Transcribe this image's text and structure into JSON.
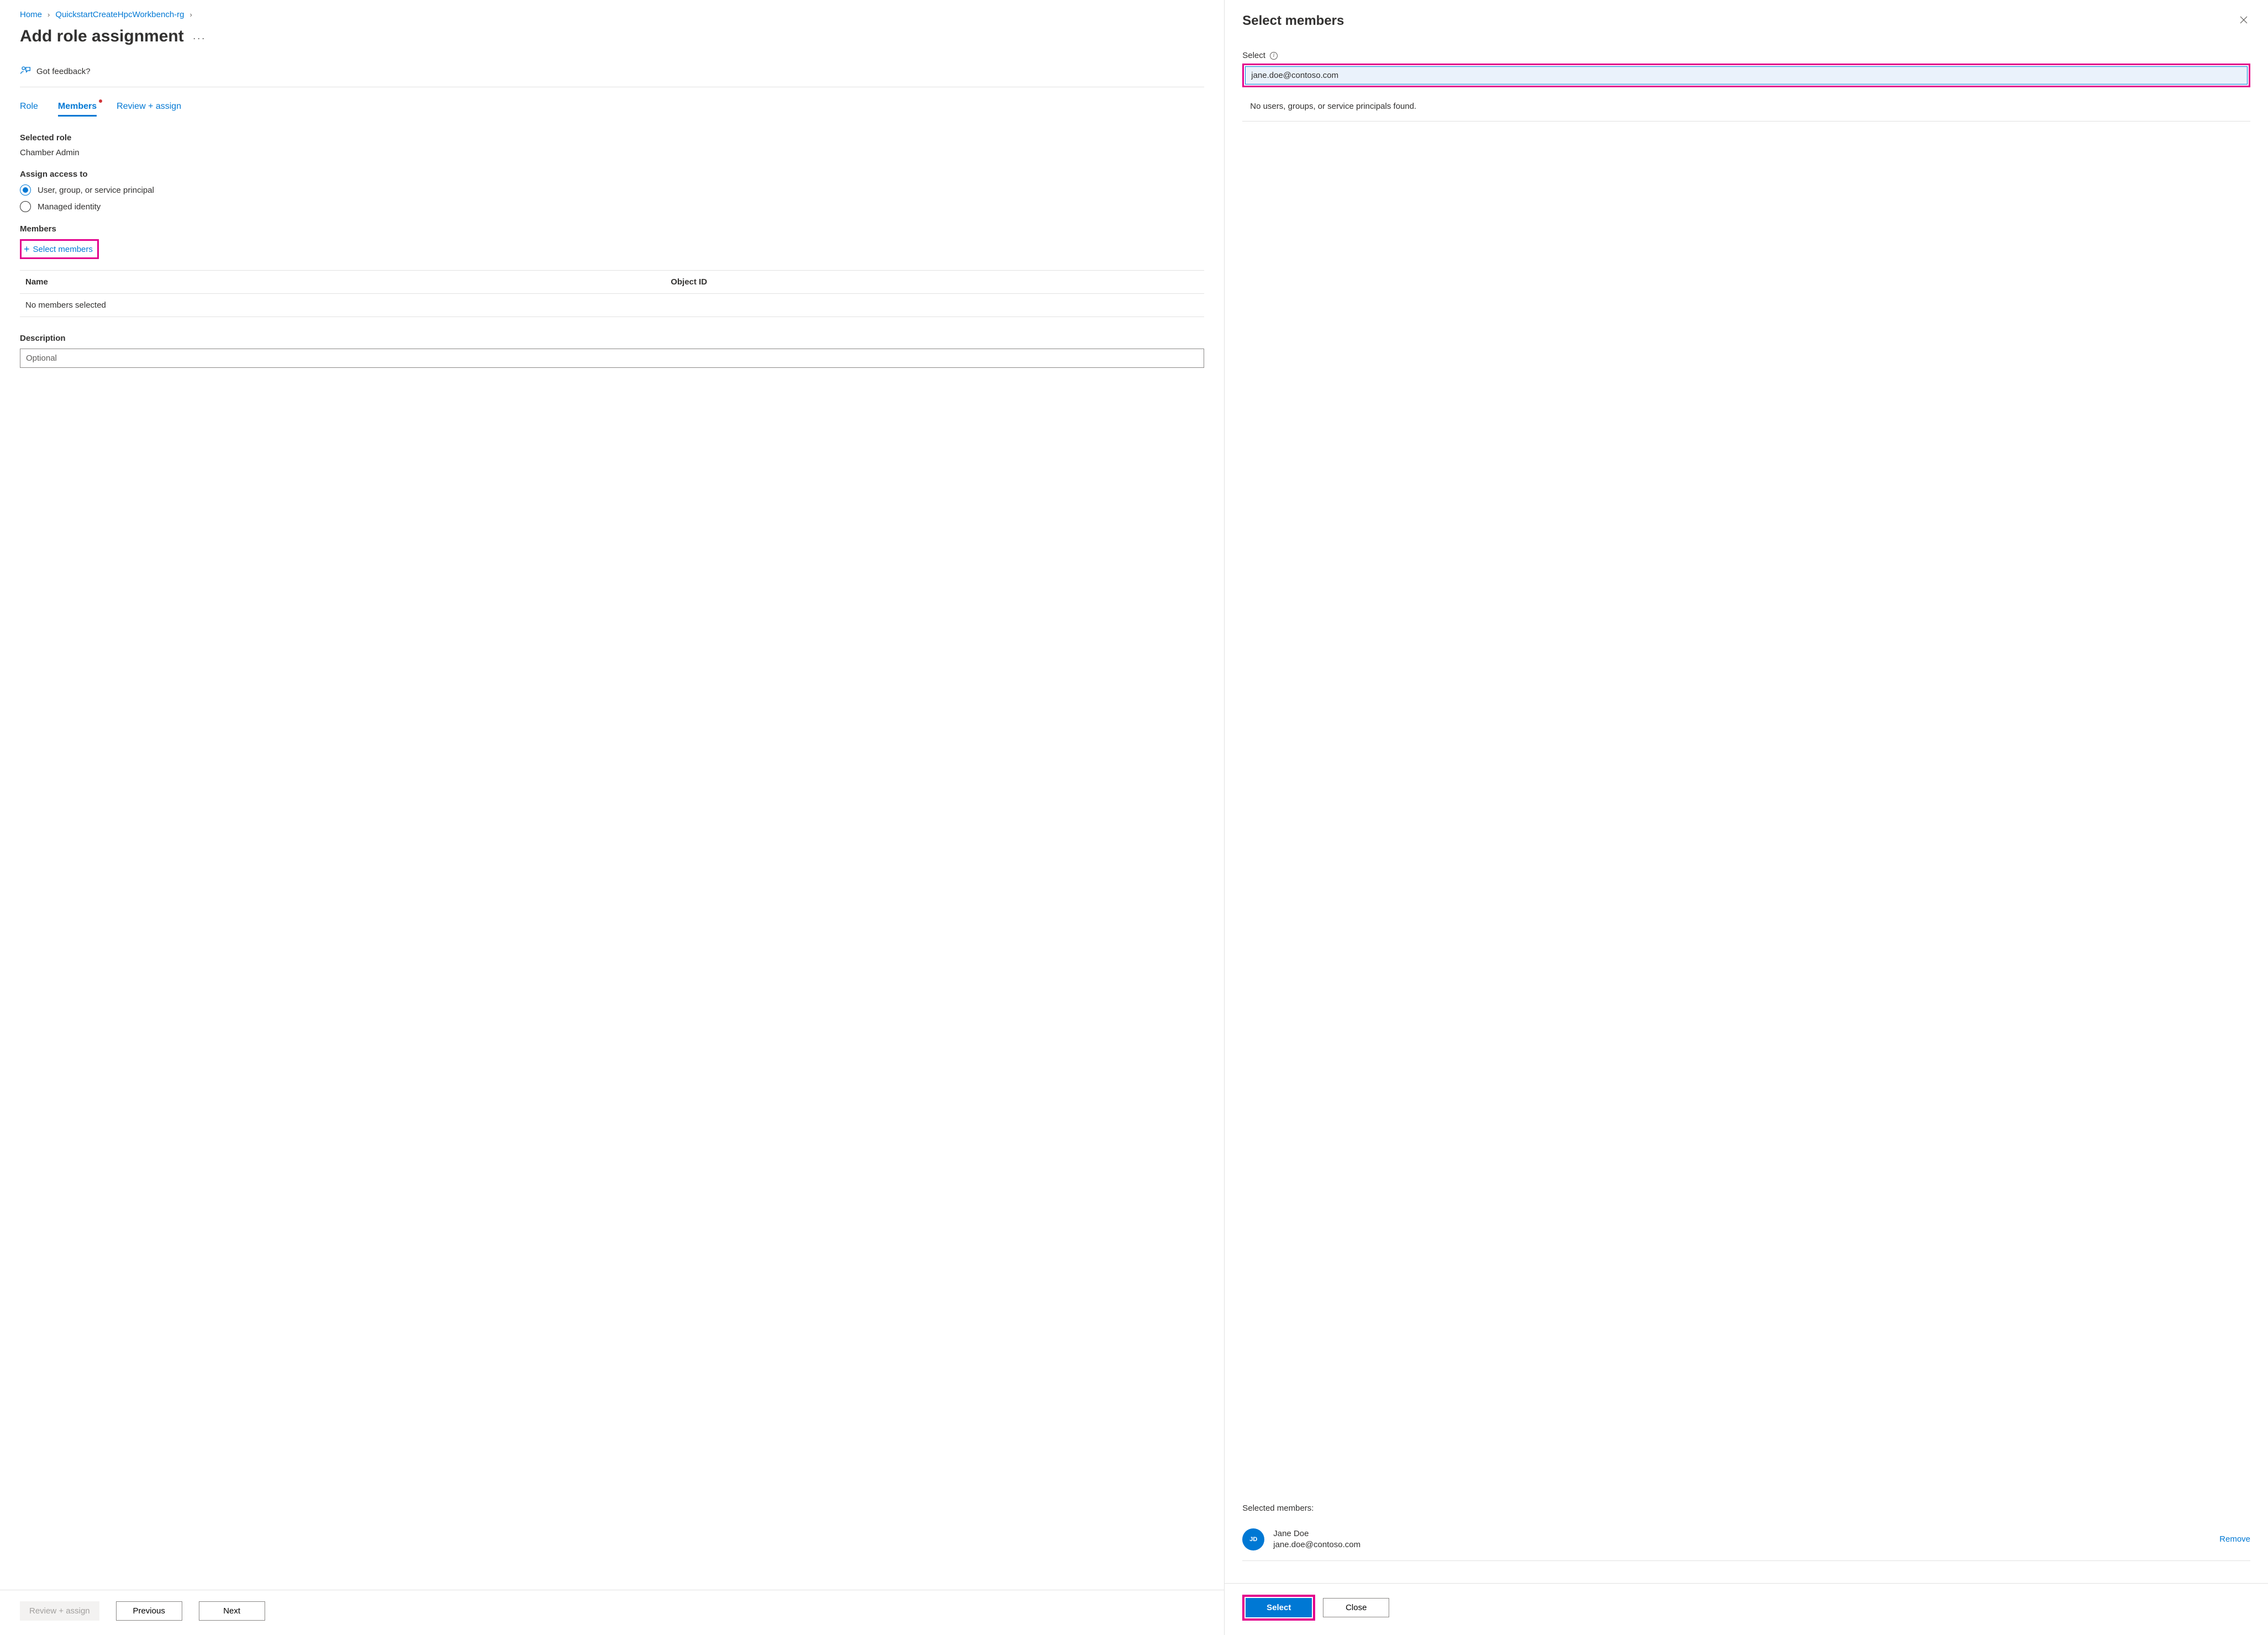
{
  "breadcrumb": {
    "home": "Home",
    "rg": "QuickstartCreateHpcWorkbench-rg"
  },
  "page_title": "Add role assignment",
  "feedback_label": "Got feedback?",
  "tabs": {
    "role": "Role",
    "members": "Members",
    "review": "Review + assign"
  },
  "selected_role": {
    "label": "Selected role",
    "value": "Chamber Admin"
  },
  "assign_access": {
    "label": "Assign access to",
    "opt_user": "User, group, or service principal",
    "opt_managed": "Managed identity"
  },
  "members_section": {
    "label": "Members",
    "select_link": "Select members",
    "col_name": "Name",
    "col_object_id": "Object ID",
    "empty": "No members selected"
  },
  "description": {
    "label": "Description",
    "placeholder": "Optional"
  },
  "left_footer": {
    "review": "Review + assign",
    "previous": "Previous",
    "next": "Next"
  },
  "flyout": {
    "title": "Select members",
    "select_label": "Select",
    "search_value": "jane.doe@contoso.com",
    "no_results": "No users, groups, or service principals found.",
    "selected_label": "Selected members:",
    "member": {
      "initials": "JD",
      "name": "Jane Doe",
      "email": "jane.doe@contoso.com",
      "remove": "Remove"
    },
    "select_btn": "Select",
    "close_btn": "Close"
  }
}
